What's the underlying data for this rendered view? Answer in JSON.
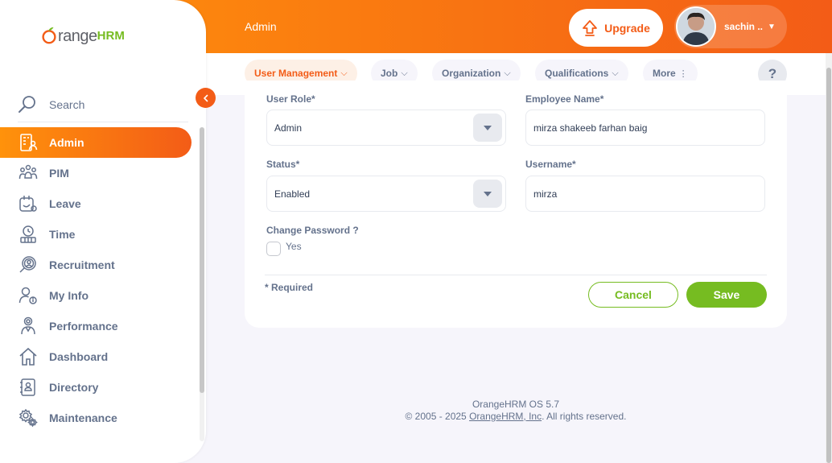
{
  "header": {
    "page_title": "Admin",
    "upgrade_label": "Upgrade",
    "user_name": "sachin .."
  },
  "subnav": {
    "tabs": [
      {
        "label": "User Management",
        "active": true
      },
      {
        "label": "Job",
        "active": false
      },
      {
        "label": "Organization",
        "active": false
      },
      {
        "label": "Qualifications",
        "active": false
      },
      {
        "label": "More",
        "active": false
      }
    ],
    "help_label": "?"
  },
  "sidebar": {
    "logo_text": "range",
    "logo_suffix": "HRM",
    "search_placeholder": "Search",
    "items": [
      {
        "label": "Admin",
        "icon": "admin-icon",
        "active": true
      },
      {
        "label": "PIM",
        "icon": "pim-icon",
        "active": false
      },
      {
        "label": "Leave",
        "icon": "leave-icon",
        "active": false
      },
      {
        "label": "Time",
        "icon": "time-icon",
        "active": false
      },
      {
        "label": "Recruitment",
        "icon": "recruitment-icon",
        "active": false
      },
      {
        "label": "My Info",
        "icon": "my-info-icon",
        "active": false
      },
      {
        "label": "Performance",
        "icon": "performance-icon",
        "active": false
      },
      {
        "label": "Dashboard",
        "icon": "dashboard-icon",
        "active": false
      },
      {
        "label": "Directory",
        "icon": "directory-icon",
        "active": false
      },
      {
        "label": "Maintenance",
        "icon": "maintenance-icon",
        "active": false
      }
    ]
  },
  "form": {
    "user_role_label": "User Role*",
    "user_role_value": "Admin",
    "employee_name_label": "Employee Name*",
    "employee_name_value": "mirza shakeeb farhan baig",
    "status_label": "Status*",
    "status_value": "Enabled",
    "username_label": "Username*",
    "username_value": "mirza",
    "change_password_label": "Change Password ?",
    "change_password_option": "Yes",
    "required_note": "* Required",
    "cancel_label": "Cancel",
    "save_label": "Save"
  },
  "footer": {
    "version": "OrangeHRM OS 5.7",
    "copyright_prefix": "© 2005 - 2025 ",
    "company_link": "OrangeHRM, Inc",
    "copyright_suffix": ". All rights reserved."
  },
  "colors": {
    "brand_orange": "#f35c17",
    "brand_orange_light": "#ff920b",
    "brand_green": "#76bc21"
  }
}
